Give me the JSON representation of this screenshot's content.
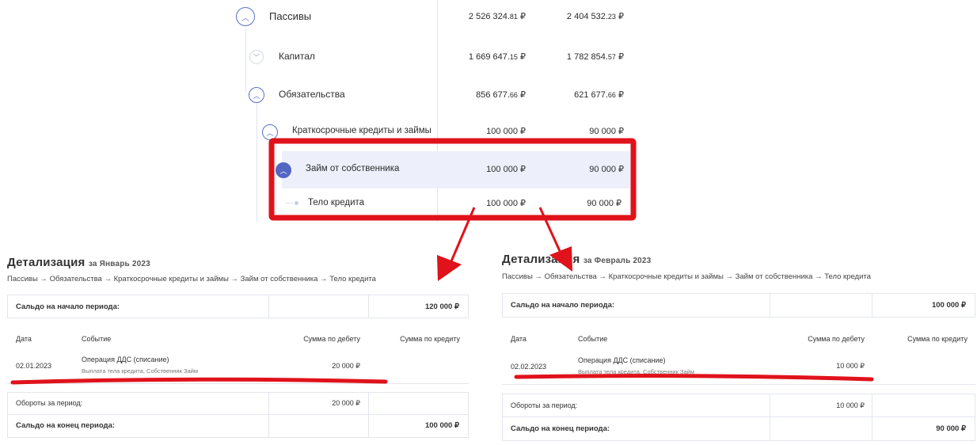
{
  "tree": {
    "rows": [
      {
        "label": "Пассивы",
        "col1_main": "2 526 324.",
        "col1_kop": "81",
        "col1_cur": " ₽",
        "col2_main": "2 404 532.",
        "col2_kop": "23",
        "col2_cur": " ₽",
        "toggle": "^"
      },
      {
        "label": "Капитал",
        "col1_main": "1 669 647.",
        "col1_kop": "15",
        "col1_cur": " ₽",
        "col2_main": "1 782 854.",
        "col2_kop": "57",
        "col2_cur": " ₽",
        "toggle": "v"
      },
      {
        "label": "Обязательства",
        "col1_main": "856 677.",
        "col1_kop": "66",
        "col1_cur": " ₽",
        "col2_main": "621 677.",
        "col2_kop": "66",
        "col2_cur": " ₽",
        "toggle": "^"
      },
      {
        "label": "Краткосрочные кредиты и займы",
        "col1": "100 000 ₽",
        "col2": "90 000 ₽",
        "toggle": "^"
      },
      {
        "label": "Займ от собственника",
        "col1": "100 000 ₽",
        "col2": "90 000 ₽",
        "toggle": "^"
      },
      {
        "label": "Тело кредита",
        "col1": "100 000 ₽",
        "col2": "90 000 ₽"
      }
    ]
  },
  "details": [
    {
      "title": "Детализация",
      "period": "за Январь 2023",
      "breadcrumb": "Пассивы → Обязательства → Краткосрочные кредиты и займы → Займ от собственника → Тело кредита",
      "opening_label": "Сальдо на начало периода:",
      "opening_value": "120 000 ₽",
      "headers": {
        "date": "Дата",
        "event": "Событие",
        "debit": "Сумма по дебету",
        "credit": "Сумма по кредиту"
      },
      "row": {
        "date": "02.01.2023",
        "event": "Операция ДДС (списание)",
        "event_sub": "Выплата тела кредита, Собственник Займ",
        "debit": "20 000 ₽",
        "credit": ""
      },
      "turnover_label": "Обороты за период:",
      "turnover_debit": "20 000 ₽",
      "closing_label": "Сальдо на конец периода:",
      "closing_value": "100 000 ₽"
    },
    {
      "title": "Детализация",
      "period": "за Февраль 2023",
      "breadcrumb": "Пассивы → Обязательства → Краткосрочные кредиты и займы → Займ от собственника → Тело кредита",
      "opening_label": "Сальдо на начало периода:",
      "opening_value": "100 000 ₽",
      "headers": {
        "date": "Дата",
        "event": "Событие",
        "debit": "Сумма по дебету",
        "credit": "Сумма по кредиту"
      },
      "row": {
        "date": "02.02.2023",
        "event": "Операция ДДС (списание)",
        "event_sub": "Выплата тела кредита, Собственник Займ",
        "debit": "10 000 ₽",
        "credit": ""
      },
      "turnover_label": "Обороты за период:",
      "turnover_debit": "10 000 ₽",
      "closing_label": "Сальдо на конец периода:",
      "closing_value": "90 000 ₽"
    }
  ],
  "colors": {
    "annotation": "#e0121b",
    "accent": "#5466c4",
    "highlight_row": "#edf0fb"
  }
}
